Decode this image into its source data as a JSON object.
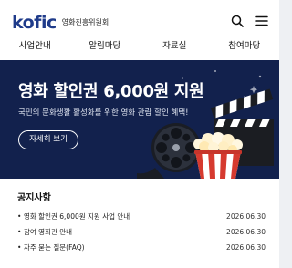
{
  "header": {
    "logo_text": "kofic",
    "logo_subtitle": "영화진흥위원회",
    "search_icon": "search-icon",
    "menu_icon": "hamburger-menu-icon"
  },
  "nav": {
    "items": [
      {
        "label": "사업안내"
      },
      {
        "label": "알림마당"
      },
      {
        "label": "자료실"
      },
      {
        "label": "참여마당"
      }
    ]
  },
  "hero": {
    "title": "영화 할인권 6,000원 지원",
    "subtitle": "국민의 문화생활 활성화를 위한 영화 관람 할인 혜택!",
    "button_label": "자세히 보기",
    "background": "#12214d",
    "illustration": [
      "film-reel-icon",
      "clapperboard-icon",
      "popcorn-icon"
    ]
  },
  "notice": {
    "title": "공지사항",
    "items": [
      {
        "bullet": "•",
        "title": "영화 할인권 6,000원 지원 사업 안내",
        "date": "2026.06.30"
      },
      {
        "bullet": "•",
        "title": "참여 영화관 안내",
        "date": "2026.06.30"
      },
      {
        "bullet": "•",
        "title": "자주 묻는 질문(FAQ)",
        "date": "2026.06.30"
      }
    ]
  },
  "colors": {
    "brand": "#1f3b8a",
    "hero_bg": "#12214d",
    "popcorn_red": "#d63a2f",
    "page_bg": "#eef0f3"
  }
}
